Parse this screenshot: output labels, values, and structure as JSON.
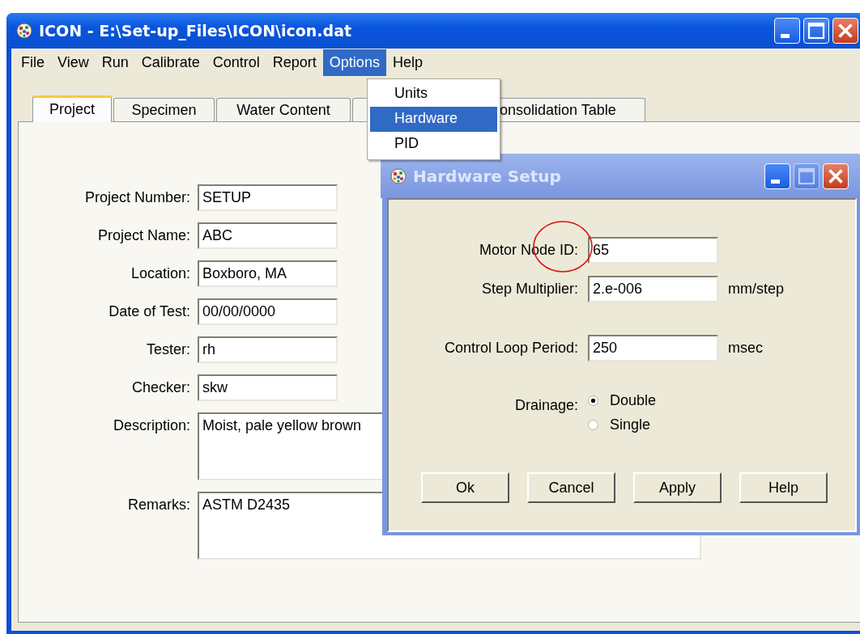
{
  "window": {
    "title": "ICON - E:\\Set-up_Files\\ICON\\icon.dat"
  },
  "menu_bar": [
    {
      "label": "File",
      "selected": false
    },
    {
      "label": "View",
      "selected": false
    },
    {
      "label": "Run",
      "selected": false
    },
    {
      "label": "Calibrate",
      "selected": false
    },
    {
      "label": "Control",
      "selected": false
    },
    {
      "label": "Report",
      "selected": false
    },
    {
      "label": "Options",
      "selected": true
    },
    {
      "label": "Help",
      "selected": false
    }
  ],
  "options_menu": [
    {
      "label": "Units",
      "selected": false
    },
    {
      "label": "Hardware",
      "selected": true
    },
    {
      "label": "PID",
      "selected": false
    }
  ],
  "tabs": [
    {
      "label": "Project",
      "selected": true
    },
    {
      "label": "Specimen",
      "selected": false
    },
    {
      "label": "Water Content",
      "selected": false
    },
    {
      "selected": false
    },
    {
      "label": "onsolidation Table",
      "selected": false
    }
  ],
  "project_form": [
    {
      "kind": "line",
      "label": "Project Number:",
      "value": "SETUP"
    },
    {
      "kind": "line",
      "label": "Project Name:",
      "value": "ABC"
    },
    {
      "kind": "line",
      "label": "Location:",
      "value": "Boxboro, MA"
    },
    {
      "kind": "line",
      "label": "Date of Test:",
      "value": "00/00/0000"
    },
    {
      "kind": "line",
      "label": "Tester:",
      "value": "rh"
    },
    {
      "kind": "line",
      "label": "Checker:",
      "value": "skw"
    },
    {
      "kind": "area",
      "label": "Description:",
      "value": "Moist, pale yellow brown"
    },
    {
      "kind": "area",
      "label": "Remarks:",
      "value": "ASTM D2435"
    }
  ],
  "dialog": {
    "title": "Hardware Setup",
    "field_groups": [
      [
        {
          "label": "Motor Node ID:",
          "value": "65"
        },
        {
          "label": "Step Multiplier:",
          "value": "2.e-006",
          "unit": "mm/step"
        }
      ],
      [
        {
          "label": "Control Loop Period:",
          "value": "250",
          "unit": "msec"
        }
      ]
    ],
    "drainage": {
      "label": "Drainage:",
      "options": [
        {
          "label": "Double",
          "selected": true
        },
        {
          "label": "Single",
          "selected": false
        }
      ]
    },
    "buttons": [
      "Ok",
      "Cancel",
      "Apply",
      "Help"
    ]
  }
}
